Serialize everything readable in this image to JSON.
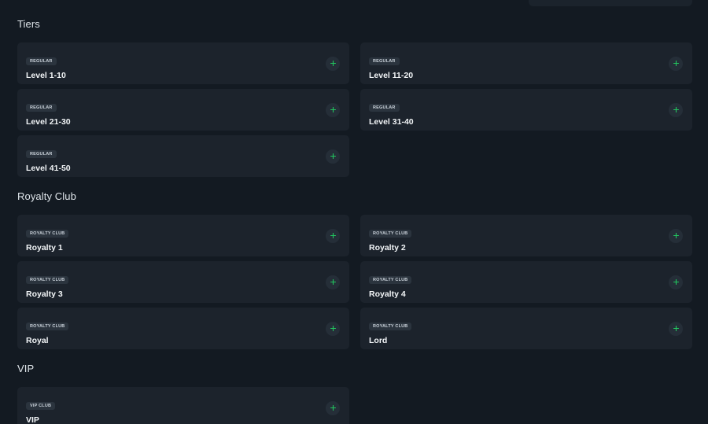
{
  "accent_color": "#22c55e",
  "icons": {
    "add": "plus-icon"
  },
  "sections": [
    {
      "title": "Tiers",
      "cards": [
        {
          "badge": "REGULAR",
          "title": "Level 1-10"
        },
        {
          "badge": "REGULAR",
          "title": "Level 11-20"
        },
        {
          "badge": "REGULAR",
          "title": "Level 21-30"
        },
        {
          "badge": "REGULAR",
          "title": "Level 31-40"
        },
        {
          "badge": "REGULAR",
          "title": "Level 41-50"
        }
      ]
    },
    {
      "title": "Royalty Club",
      "cards": [
        {
          "badge": "ROYALTY CLUB",
          "title": "Royalty 1"
        },
        {
          "badge": "ROYALTY CLUB",
          "title": "Royalty 2"
        },
        {
          "badge": "ROYALTY CLUB",
          "title": "Royalty 3"
        },
        {
          "badge": "ROYALTY CLUB",
          "title": "Royalty 4"
        },
        {
          "badge": "ROYALTY CLUB",
          "title": "Royal"
        },
        {
          "badge": "ROYALTY CLUB",
          "title": "Lord"
        }
      ]
    },
    {
      "title": "VIP",
      "cards": [
        {
          "badge": "VIP CLUB",
          "title": "VIP"
        }
      ]
    }
  ]
}
